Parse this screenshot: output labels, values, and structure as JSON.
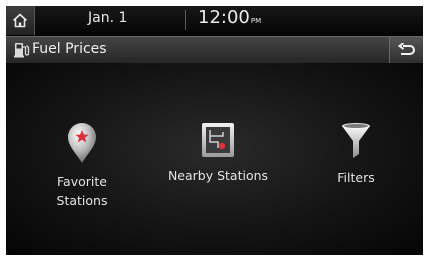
{
  "status_bar": {
    "date": "Jan. 1",
    "time": "12:00",
    "ampm": "PM"
  },
  "header": {
    "title": "Fuel Prices"
  },
  "menu": {
    "favorite": {
      "line1": "Favorite",
      "line2": "Stations"
    },
    "nearby": {
      "label": "Nearby Stations"
    },
    "filters": {
      "label": "Filters"
    }
  },
  "icons": {
    "home": "home-icon",
    "title": "fuel-pump-icon",
    "back": "back-arrow-icon",
    "favorite": "star-pin-icon",
    "nearby": "map-location-icon",
    "filters": "funnel-icon"
  },
  "colors": {
    "accent_red": "#d9323a",
    "text": "#e4e4e4"
  }
}
